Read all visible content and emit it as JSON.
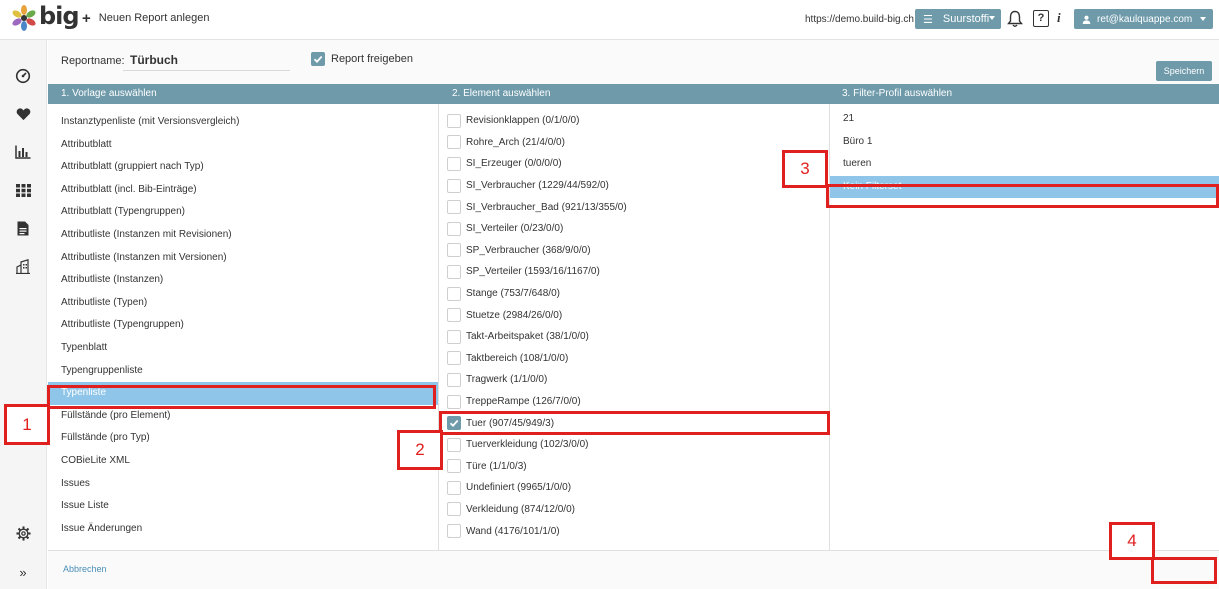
{
  "app": {
    "logo_text": "big",
    "new_report": "Neuen Report anlegen",
    "url": "https://demo.build-big.ch",
    "project": "Suurstoffi",
    "help": "?",
    "info": "i",
    "user": "ret@kaulquappe.com"
  },
  "form": {
    "report_label": "Reportname:",
    "report_value": "Türbuch",
    "publish_label": "Report freigeben",
    "publish_checked": true
  },
  "columns": {
    "template_head": "1. Vorlage auswählen",
    "element_head": "2. Element auswählen",
    "filter_head": "3. Filter-Profil auswählen"
  },
  "templates": [
    "Instanztypenliste (mit Versionsvergleich)",
    "Attributblatt",
    "Attributblatt (gruppiert nach Typ)",
    "Attributblatt (incl. Bib-Einträge)",
    "Attributblatt (Typengruppen)",
    "Attributliste (Instanzen mit Revisionen)",
    "Attributliste (Instanzen mit Versionen)",
    "Attributliste (Instanzen)",
    "Attributliste (Typen)",
    "Attributliste (Typengruppen)",
    "Typenblatt",
    "Typengruppenliste",
    "Typenliste",
    "Füllstände (pro Element)",
    "Füllstände (pro Typ)",
    "COBieLite XML",
    "Issues",
    "Issue Liste",
    "Issue Änderungen"
  ],
  "elements": [
    "Revisionklappen (0/1/0/0)",
    "Rohre_Arch (21/4/0/0)",
    "SI_Erzeuger (0/0/0/0)",
    "SI_Verbraucher (1229/44/592/0)",
    "SI_Verbraucher_Bad (921/13/355/0)",
    "SI_Verteiler (0/23/0/0)",
    "SP_Verbraucher (368/9/0/0)",
    "SP_Verteiler (1593/16/1167/0)",
    "Stange (753/7/648/0)",
    "Stuetze (2984/26/0/0)",
    "Takt-Arbeitspaket (38/1/0/0)",
    "Taktbereich (108/1/0/0)",
    "Tragwerk (1/1/0/0)",
    "TreppeRampe (126/7/0/0)",
    "Tuer (907/45/949/3)",
    "Tuerverkleidung (102/3/0/0)",
    "Türe (1/1/0/3)",
    "Undefiniert (9965/1/0/0)",
    "Verkleidung (874/12/0/0)",
    "Wand (4176/101/1/0)"
  ],
  "filters": [
    "21",
    "Büro 1",
    "tueren",
    "Kein Filterset"
  ],
  "footer": {
    "cancel": "Abbrechen",
    "save": "Speichern"
  },
  "annotations": [
    "1",
    "2",
    "3",
    "4"
  ],
  "colors": {
    "accent": "#6e9aaa",
    "selection": "#8ec5e8",
    "annotation": "#e0201f"
  }
}
